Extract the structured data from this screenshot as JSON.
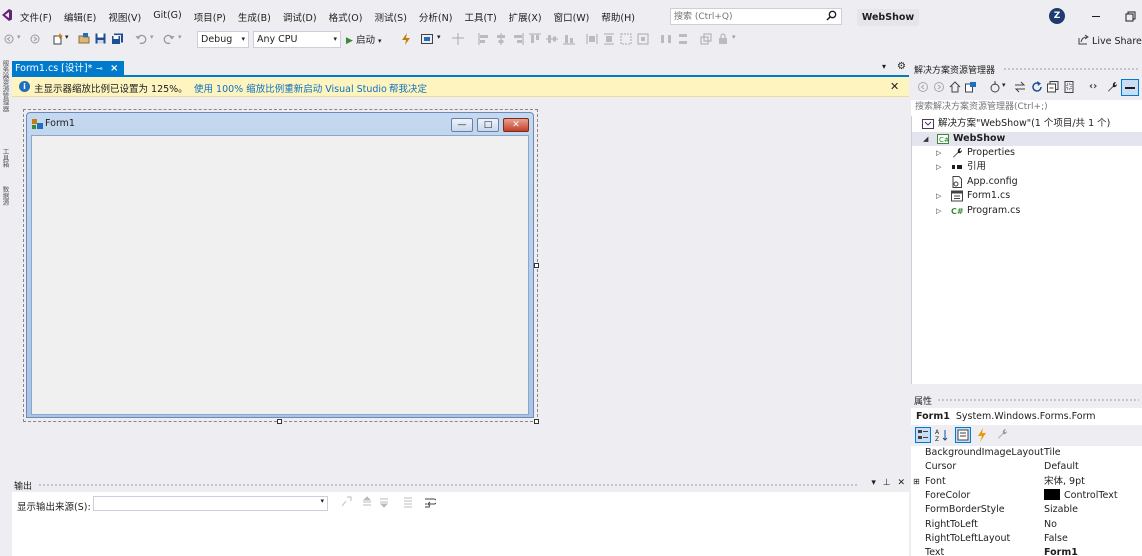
{
  "menubar": {
    "items": [
      "文件(F)",
      "编辑(E)",
      "视图(V)",
      "Git(G)",
      "项目(P)",
      "生成(B)",
      "调试(D)",
      "格式(O)",
      "测试(S)",
      "分析(N)",
      "工具(T)",
      "扩展(X)",
      "窗口(W)",
      "帮助(H)"
    ],
    "search_placeholder": "搜索 (Ctrl+Q)",
    "solution_name": "WebShow",
    "avatar_initial": "Z"
  },
  "toolbar": {
    "config": "Debug",
    "platform": "Any CPU",
    "start_label": "启动",
    "live_share": "Live Share"
  },
  "left_strip": [
    "服务器资源管理器",
    "工具箱",
    "数据源"
  ],
  "document": {
    "tab_label": "Form1.cs [设计]*",
    "info_message": "主显示器缩放比例已设置为 125%。",
    "info_link_restart": "使用 100% 缩放比例重新启动 Visual Studio",
    "info_link_help": "帮我决定",
    "form_caption": "Form1"
  },
  "output": {
    "title": "输出",
    "source_label": "显示输出来源(S):",
    "source_value": ""
  },
  "solution_explorer": {
    "title": "解决方案资源管理器",
    "search_placeholder": "搜索解决方案资源管理器(Ctrl+;)",
    "tree": [
      {
        "label": "解决方案\"WebShow\"(1 个项目/共 1 个)",
        "icon": "solution-icon"
      },
      {
        "label": "WebShow",
        "icon": "csharp-project-icon"
      },
      {
        "label": "Properties",
        "icon": "wrench-icon"
      },
      {
        "label": "引用",
        "icon": "references-icon"
      },
      {
        "label": "App.config",
        "icon": "config-file-icon"
      },
      {
        "label": "Form1.cs",
        "icon": "form-file-icon"
      },
      {
        "label": "Program.cs",
        "icon": "csharp-file-icon"
      }
    ]
  },
  "properties": {
    "title": "属性",
    "object_name": "Form1",
    "object_type": "System.Windows.Forms.Form",
    "rows": [
      {
        "name": "BackgroundImageLayout",
        "value": "Tile"
      },
      {
        "name": "Cursor",
        "value": "Default"
      },
      {
        "name": "Font",
        "value": "宋体, 9pt"
      },
      {
        "name": "ForeColor",
        "value": "ControlText"
      },
      {
        "name": "FormBorderStyle",
        "value": "Sizable"
      },
      {
        "name": "RightToLeft",
        "value": "No"
      },
      {
        "name": "RightToLeftLayout",
        "value": "False"
      },
      {
        "name": "Text",
        "value": "Form1"
      }
    ]
  },
  "colors": {
    "accent": "#007acc",
    "infobar_bg": "#fdf4bf",
    "link": "#0e70c0",
    "avatar_bg": "#1e3b70"
  }
}
